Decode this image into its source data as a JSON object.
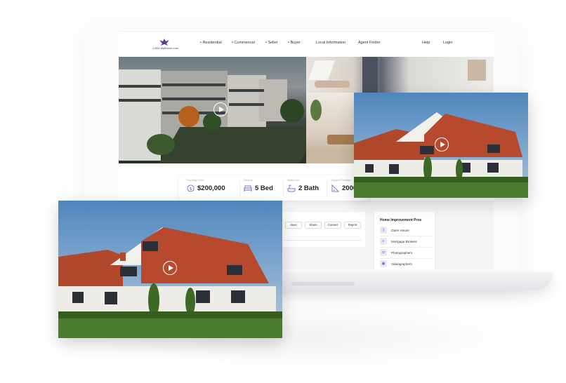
{
  "header": {
    "logo_text": "1-800-MyBroker.com",
    "nav": [
      {
        "label": "• Residential"
      },
      {
        "label": "• Commercial"
      },
      {
        "label": "• Seller"
      },
      {
        "label": "• Buyer"
      },
      {
        "label": "Local Information"
      },
      {
        "label": "Agent Finder"
      }
    ],
    "help_label": "Help",
    "login_label": "Login"
  },
  "stats": [
    {
      "label": "Property Price",
      "value": "$200,000",
      "icon": "dollar-icon"
    },
    {
      "label": "Rooms",
      "value": "5 Bed",
      "icon": "bed-icon"
    },
    {
      "label": "Bathroom",
      "value": "2 Bath",
      "icon": "bath-icon"
    },
    {
      "label": "Square Footage",
      "value": "2000",
      "icon": "ruler-icon"
    }
  ],
  "actions": {
    "save_label": "Save",
    "share_label": "Share",
    "contact_label": "Contact",
    "report_label": "Report"
  },
  "pros": {
    "title": "Home Improvement Pros",
    "items": [
      {
        "label": "Open House",
        "icon": "door-icon"
      },
      {
        "label": "Mortgage Brokers",
        "icon": "document-icon"
      },
      {
        "label": "Photographers",
        "icon": "camera-icon"
      },
      {
        "label": "Videographers",
        "icon": "video-icon"
      }
    ]
  },
  "colors": {
    "accent": "#6a73c8",
    "sky": "#5f93c4",
    "roof": "#b0482c",
    "grass": "#4c7d2e"
  }
}
